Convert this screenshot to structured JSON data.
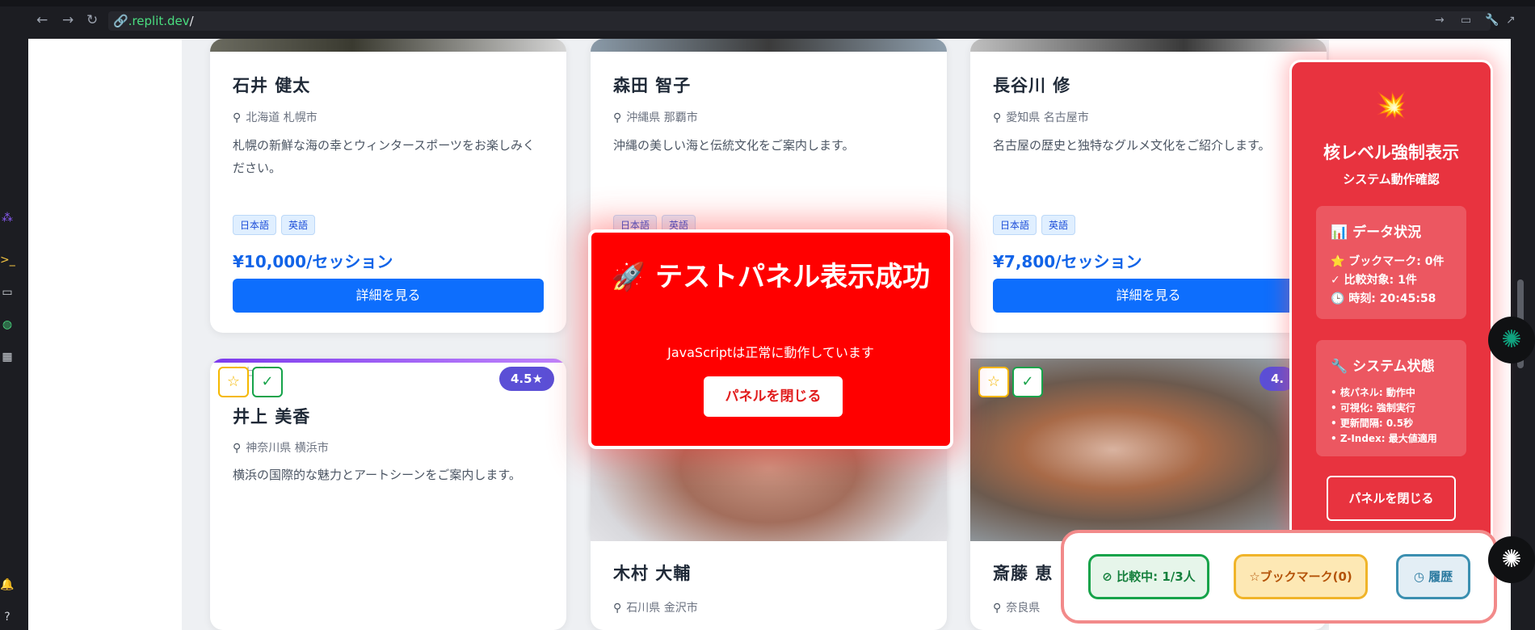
{
  "browser": {
    "url_domain": ".replit.dev",
    "url_path": "/"
  },
  "cards": {
    "c1": {
      "name": "石井 健太",
      "location": "北海道 札幌市",
      "description": "札幌の新鮮な海の幸とウィンタースポーツをお楽しみください。",
      "tags": [
        "日本語",
        "英語"
      ],
      "price": "¥10,000/セッション",
      "button": "詳細を見る"
    },
    "c2": {
      "name": "森田 智子",
      "location": "沖縄県 那覇市",
      "description": "沖縄の美しい海と伝統文化をご案内します。",
      "tags": [
        "日本語",
        "英語"
      ]
    },
    "c3": {
      "name": "長谷川 修",
      "location": "愛知県 名古屋市",
      "description": "名古屋の歴史と独特なグルメ文化をご紹介します。",
      "tags": [
        "日本語",
        "英語"
      ],
      "price": "¥7,800/セッション",
      "button": "詳細を見る"
    },
    "c4": {
      "name": "井上 美香",
      "location": "神奈川県 横浜市",
      "description": "横浜の国際的な魅力とアートシーンをご案内します。",
      "rating": "4.5★",
      "broken_alt": "井上 美香"
    },
    "c5": {
      "name": "木村 大輔",
      "location": "石川県 金沢市"
    },
    "c6": {
      "name": "斎藤 恵",
      "location": "奈良県",
      "rating": "4."
    }
  },
  "test_panel": {
    "icon": "🚀",
    "title": "テストパネル表示成功",
    "subtitle": "JavaScriptは正常に動作しています",
    "close": "パネルを閉じる"
  },
  "nuke_panel": {
    "icon": "💥",
    "title": "核レベル強制表示",
    "subtitle": "システム動作確認",
    "data_title": "📊 データ状況",
    "data_lines": [
      "⭐ ブックマーク: 0件",
      "✓ 比較対象: 1件",
      "🕒 時刻: 20:45:58"
    ],
    "system_title": "🔧 システム状態",
    "system_lines": [
      "• 核パネル: 動作中",
      "• 可視化: 強制実行",
      "• 更新間隔: 0.5秒",
      "• Z-Index: 最大値適用"
    ],
    "close": "パネルを閉じる"
  },
  "bottom_bar": {
    "compare": "比較中: 1/3人",
    "bookmark": "ブックマーク(0)",
    "history": "履歴"
  },
  "colors": {
    "accent_blue": "#0d6efd",
    "price_blue": "#1264e8",
    "test_red": "#ff0000",
    "nuke_red": "#e8333f",
    "rating_purple": "#5b4fd6"
  }
}
